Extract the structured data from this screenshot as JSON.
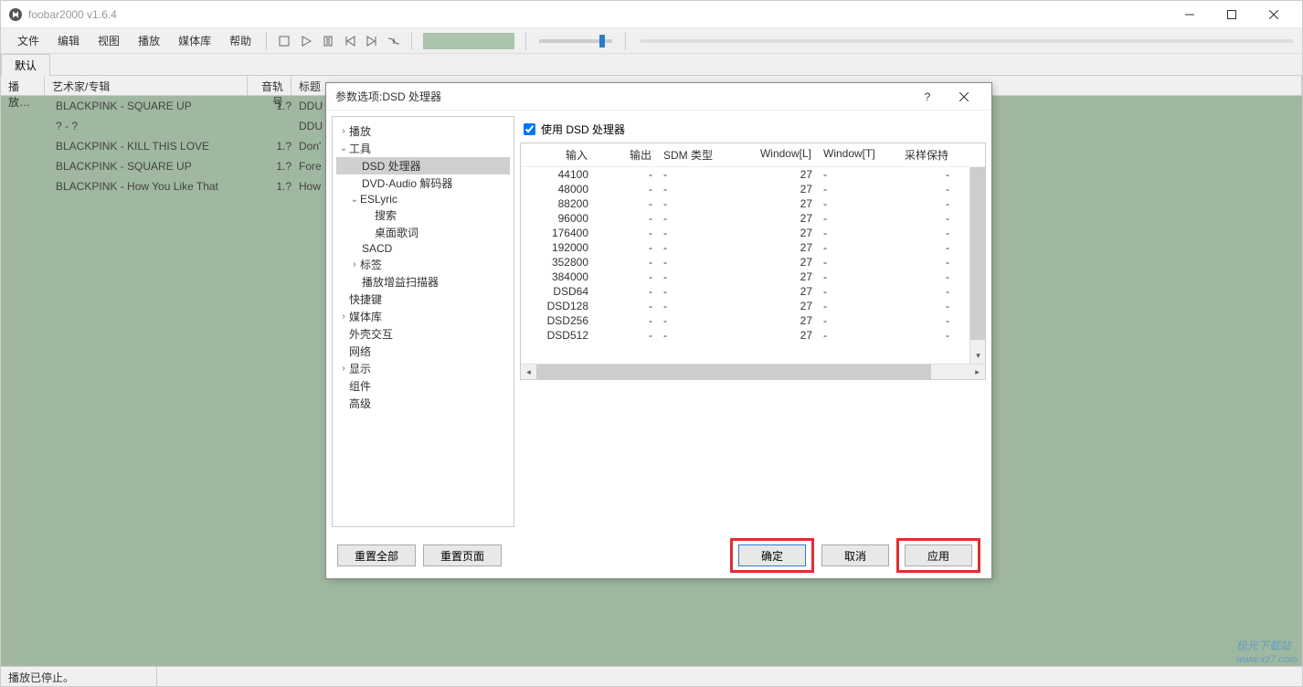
{
  "app": {
    "title": "foobar2000 v1.6.4",
    "status": "播放已停止。"
  },
  "menu": [
    "文件",
    "编辑",
    "视图",
    "播放",
    "媒体库",
    "帮助"
  ],
  "tabs": {
    "default": "默认"
  },
  "playlist": {
    "headers": {
      "play": "播放…",
      "artist": "艺术家/专辑",
      "track": "音轨号",
      "title": "标题"
    },
    "rows": [
      {
        "artist": "BLACKPINK - SQUARE UP",
        "track": "1.?",
        "title": "DDU"
      },
      {
        "artist": "? - ?",
        "track": "",
        "title": "DDU"
      },
      {
        "artist": "BLACKPINK - KILL THIS LOVE",
        "track": "1.?",
        "title": "Don'"
      },
      {
        "artist": "BLACKPINK - SQUARE UP",
        "track": "1.?",
        "title": "Fore"
      },
      {
        "artist": "BLACKPINK - How You Like That",
        "track": "1.?",
        "title": "How"
      }
    ]
  },
  "dialog": {
    "title": "参数选项:DSD 处理器",
    "tree": {
      "playback": "播放",
      "tools": "工具",
      "dsd": "DSD 处理器",
      "dvd": "DVD-Audio 解码器",
      "eslyric": "ESLyric",
      "search": "搜索",
      "desktop_lyric": "桌面歌词",
      "sacd": "SACD",
      "tags": "标签",
      "replaygain": "播放增益扫描器",
      "hotkeys": "快捷键",
      "media_lib": "媒体库",
      "shell": "外壳交互",
      "network": "网络",
      "display": "显示",
      "components": "组件",
      "advanced": "高级"
    },
    "use_dsd_label": "使用 DSD 处理器",
    "table": {
      "headers": {
        "input": "输入",
        "output": "输出",
        "sdm": "SDM 类型",
        "winl": "Window[L]",
        "wint": "Window[T]",
        "hold": "采样保持"
      },
      "rows": [
        {
          "input": "44100",
          "output": "-",
          "sdm": "-",
          "winl": "27",
          "wint": "-",
          "hold": "-"
        },
        {
          "input": "48000",
          "output": "-",
          "sdm": "-",
          "winl": "27",
          "wint": "-",
          "hold": "-"
        },
        {
          "input": "88200",
          "output": "-",
          "sdm": "-",
          "winl": "27",
          "wint": "-",
          "hold": "-"
        },
        {
          "input": "96000",
          "output": "-",
          "sdm": "-",
          "winl": "27",
          "wint": "-",
          "hold": "-"
        },
        {
          "input": "176400",
          "output": "-",
          "sdm": "-",
          "winl": "27",
          "wint": "-",
          "hold": "-"
        },
        {
          "input": "192000",
          "output": "-",
          "sdm": "-",
          "winl": "27",
          "wint": "-",
          "hold": "-"
        },
        {
          "input": "352800",
          "output": "-",
          "sdm": "-",
          "winl": "27",
          "wint": "-",
          "hold": "-"
        },
        {
          "input": "384000",
          "output": "-",
          "sdm": "-",
          "winl": "27",
          "wint": "-",
          "hold": "-"
        },
        {
          "input": "DSD64",
          "output": "-",
          "sdm": "-",
          "winl": "27",
          "wint": "-",
          "hold": "-"
        },
        {
          "input": "DSD128",
          "output": "-",
          "sdm": "-",
          "winl": "27",
          "wint": "-",
          "hold": "-"
        },
        {
          "input": "DSD256",
          "output": "-",
          "sdm": "-",
          "winl": "27",
          "wint": "-",
          "hold": "-"
        },
        {
          "input": "DSD512",
          "output": "-",
          "sdm": "-",
          "winl": "27",
          "wint": "-",
          "hold": "-"
        }
      ]
    },
    "buttons": {
      "reset_all": "重置全部",
      "reset_page": "重置页面",
      "ok": "确定",
      "cancel": "取消",
      "apply": "应用"
    }
  },
  "watermark": {
    "text": "极光下载站",
    "url": "www.xz7.com"
  }
}
